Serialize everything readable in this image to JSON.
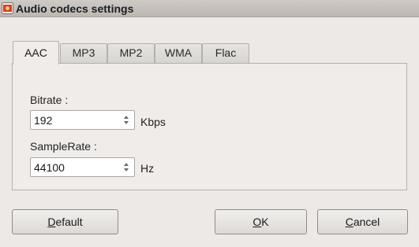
{
  "window": {
    "title": "Audio codecs settings",
    "icon": "app-icon"
  },
  "tabs": [
    {
      "label": "AAC",
      "active": true
    },
    {
      "label": "MP3",
      "active": false
    },
    {
      "label": "MP2",
      "active": false
    },
    {
      "label": "WMA",
      "active": false
    },
    {
      "label": "Flac",
      "active": false
    }
  ],
  "fields": {
    "bitrate": {
      "label": "Bitrate :",
      "value": "192",
      "unit": "Kbps"
    },
    "samplerate": {
      "label": "SampleRate :",
      "value": "44100",
      "unit": "Hz"
    }
  },
  "buttons": {
    "default": {
      "accel": "D",
      "rest": "efault"
    },
    "ok": {
      "accel": "O",
      "rest": "K"
    },
    "cancel": {
      "accel": "C",
      "rest": "ancel"
    }
  }
}
